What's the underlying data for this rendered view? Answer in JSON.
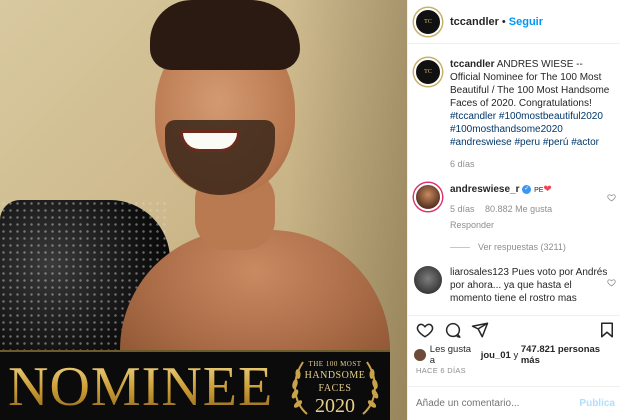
{
  "post": {
    "image": {
      "banner_text": "NOMINEE",
      "award_line1": "THE 100 MOST",
      "award_line2": "HANDSOME",
      "award_line3": "FACES",
      "award_year": "2020"
    }
  },
  "header": {
    "avatar_text": "TC",
    "username": "tccandler",
    "separator": "•",
    "follow_label": "Seguir"
  },
  "caption": {
    "username": "tccandler",
    "text": "ANDRES WIESE -- Official Nominee for The 100 Most Beautiful / The 100 Most Handsome Faces of 2020. Congratulations!",
    "tags": [
      "#tccandler",
      "#100mostbeautiful2020",
      "#100mosthandsome2020",
      "#andreswiese",
      "#peru",
      "#perú",
      "#actor"
    ],
    "time": "6 días"
  },
  "comments": [
    {
      "username": "andreswiese_r",
      "verified_mark": "✓",
      "text_suffix": "PE",
      "heart": "❤",
      "time": "5 días",
      "likes": "80.882 Me gusta",
      "reply_label": "Responder",
      "view_replies": "Ver respuestas (3211)"
    },
    {
      "username": "liarosales123",
      "text": "Pues voto por Andrés por ahora... ya que hasta el momento tiene el rostro mas"
    }
  ],
  "likes": {
    "prefix": "Les gusta a",
    "user": "jou_01",
    "joiner": "y",
    "others": "747.821 personas más"
  },
  "timestamp": "HACE 6 DÍAS",
  "add_comment": {
    "placeholder": "Añade un comentario...",
    "publish_label": "Publica"
  },
  "icons": {
    "like": "heart-outline",
    "comment": "speech-bubble",
    "share": "paper-plane",
    "save": "bookmark"
  },
  "colors": {
    "link": "#0095f6",
    "hashtag": "#00376b",
    "muted": "#8e8e8e",
    "gold": "#cfa94a"
  }
}
